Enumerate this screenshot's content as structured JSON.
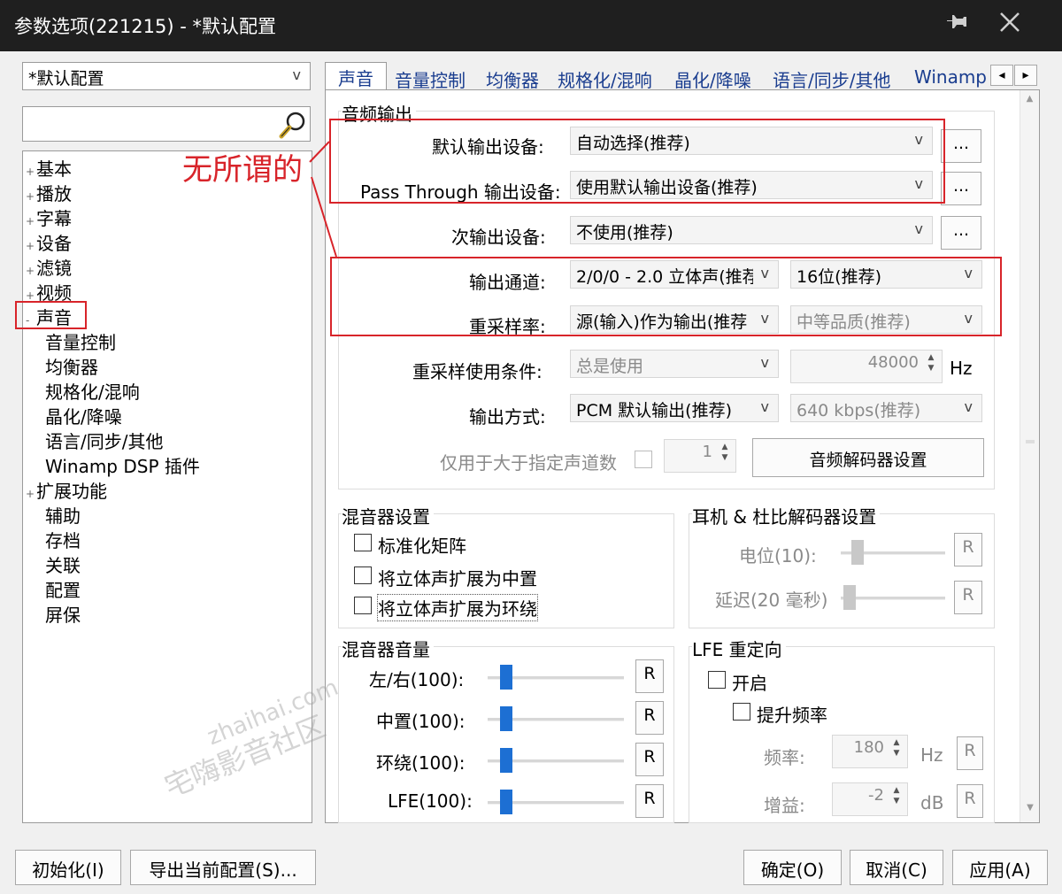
{
  "window": {
    "title": "参数选项(221215) - *默认配置",
    "pin_icon": "pin-icon",
    "close_icon": "close-icon"
  },
  "left": {
    "profile_select": {
      "value": "*默认配置"
    },
    "search": {
      "value": "",
      "icon": "search-icon"
    },
    "tree": [
      {
        "label": "基本",
        "expander": "+"
      },
      {
        "label": "播放",
        "expander": "+"
      },
      {
        "label": "字幕",
        "expander": "+"
      },
      {
        "label": "设备",
        "expander": "+"
      },
      {
        "label": "滤镜",
        "expander": "+"
      },
      {
        "label": "视频",
        "expander": "+"
      },
      {
        "label": "声音",
        "expander": "-"
      },
      {
        "label": "音量控制"
      },
      {
        "label": "均衡器"
      },
      {
        "label": "规格化/混响"
      },
      {
        "label": "晶化/降噪"
      },
      {
        "label": "语言/同步/其他"
      },
      {
        "label": "Winamp DSP 插件"
      },
      {
        "label": "扩展功能",
        "expander": "+"
      },
      {
        "label": "辅助"
      },
      {
        "label": "存档"
      },
      {
        "label": "关联"
      },
      {
        "label": "配置"
      },
      {
        "label": "屏保"
      }
    ]
  },
  "tabs": [
    "声音",
    "音量控制",
    "均衡器",
    "规格化/混响",
    "晶化/降噪",
    "语言/同步/其他",
    "Winamp"
  ],
  "tab_scroll": {
    "left": "◂",
    "right": "▸"
  },
  "annotation": {
    "text": "无所谓的",
    "color": "#d8242a"
  },
  "audio_output": {
    "group_title": "音频输出",
    "default_device": {
      "label": "默认输出设备:",
      "value": "自动选择(推荐)",
      "more": "..."
    },
    "passthrough_device": {
      "label": "Pass Through 输出设备:",
      "value": "使用默认输出设备(推荐)",
      "more": "..."
    },
    "secondary_device": {
      "label": "次输出设备:",
      "value": "不使用(推荐)",
      "more": "..."
    },
    "channels": {
      "label": "输出通道:",
      "value": "2/0/0 - 2.0 立体声(推荐",
      "bits": "16位(推荐)"
    },
    "resample_rate": {
      "label": "重采样率:",
      "value": "源(输入)作为输出(推荐",
      "quality": "中等品质(推荐)"
    },
    "resample_condition": {
      "label": "重采样使用条件:",
      "value": "总是使用",
      "rate": "48000",
      "unit": "Hz"
    },
    "output_mode": {
      "label": "输出方式:",
      "value": "PCM 默认输出(推荐)",
      "bitrate": "640 kbps(推荐)"
    },
    "only_above": {
      "label": "仅用于大于指定声道数",
      "value": "1"
    },
    "decoder_button": "音频解码器设置"
  },
  "mixer_settings": {
    "title": "混音器设置",
    "options": [
      "标准化矩阵",
      "将立体声扩展为中置",
      "将立体声扩展为环绕"
    ]
  },
  "headphone": {
    "title": "耳机 & 杜比解码器设置",
    "level": {
      "label": "电位(10):",
      "value": 10,
      "reset": "R"
    },
    "delay": {
      "label": "延迟(20 毫秒)",
      "value": 20,
      "reset": "R"
    }
  },
  "mixer_volume": {
    "title": "混音器音量",
    "rows": [
      {
        "label": "左/右(100):",
        "value": 100,
        "reset": "R"
      },
      {
        "label": "中置(100):",
        "value": 100,
        "reset": "R"
      },
      {
        "label": "环绕(100):",
        "value": 100,
        "reset": "R"
      },
      {
        "label": "LFE(100):",
        "value": 100,
        "reset": "R"
      }
    ]
  },
  "lfe": {
    "title": "LFE 重定向",
    "enable": "开启",
    "boost": "提升频率",
    "freq": {
      "label": "频率:",
      "value": "180",
      "unit": "Hz",
      "reset": "R"
    },
    "gain": {
      "label": "增益:",
      "value": "-2",
      "unit": "dB",
      "reset": "R"
    }
  },
  "watermark": {
    "line1": "zhaihai.com",
    "line2": "宅嗨影音社区"
  },
  "footer": {
    "reset": "初始化(I)",
    "export": "导出当前配置(S)...",
    "ok": "确定(O)",
    "cancel": "取消(C)",
    "apply": "应用(A)"
  },
  "colors": {
    "title_bg": "#1f1f1f",
    "accent": "#1d6fd3",
    "annotation": "#d8242a"
  }
}
